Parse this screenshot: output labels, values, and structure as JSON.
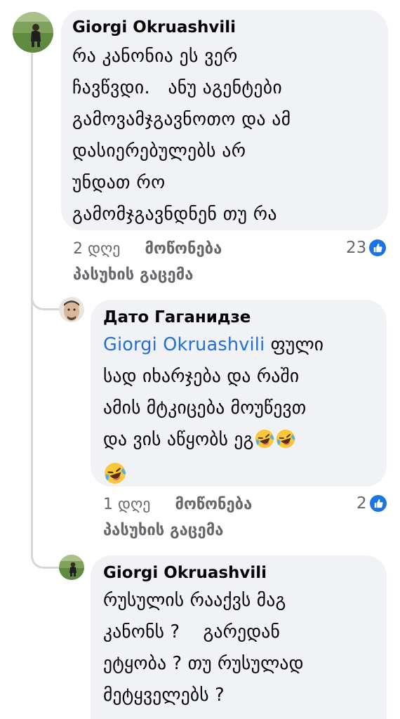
{
  "comments": [
    {
      "author": "Giorgi Okruashvili",
      "lines": [
        "რა კანონია ეს ვერ",
        "ჩავწვდი.   ანუ აგენტები",
        "გამოვამჯგავნოთო და ამ",
        "დასიერებულებს არ",
        "უნდათ რო",
        "გამომჯგავნდნენ თუ რა"
      ],
      "time": "2 დღე",
      "like_label": "მოწონება",
      "reply_label": "პასუხის გაცემა",
      "reaction_count": "23",
      "reaction_icon": "like-icon"
    },
    {
      "author": "Дато Гаганидзе",
      "mention": "Giorgi Okruashvili",
      "lines": [
        " ფული",
        "სად იხარჯება და რაში",
        "ამის მტკიცება მოუწევთ",
        "და ვის აწყობს ეგ"
      ],
      "emojis": [
        "laughing-tears-emoji",
        "laughing-tears-emoji",
        "laughing-tears-emoji"
      ],
      "time": "1 დღე",
      "like_label": "მოწონება",
      "reply_label": "პასუხის გაცემა",
      "reaction_count": "2",
      "reaction_icon": "like-icon"
    },
    {
      "author": "Giorgi Okruashvili",
      "lines": [
        "რუსულის რააქვს მაგ",
        "კანონს ?    გარედან",
        "ეტყობა ? თუ რუსულად",
        "მეტყველებს ?"
      ]
    }
  ],
  "colors": {
    "bubble": "#f0f2f5",
    "text": "#050505",
    "meta": "#65676b",
    "mention": "#216fdb",
    "like_badge": "#1b74e4",
    "thread": "#d3d6db"
  }
}
